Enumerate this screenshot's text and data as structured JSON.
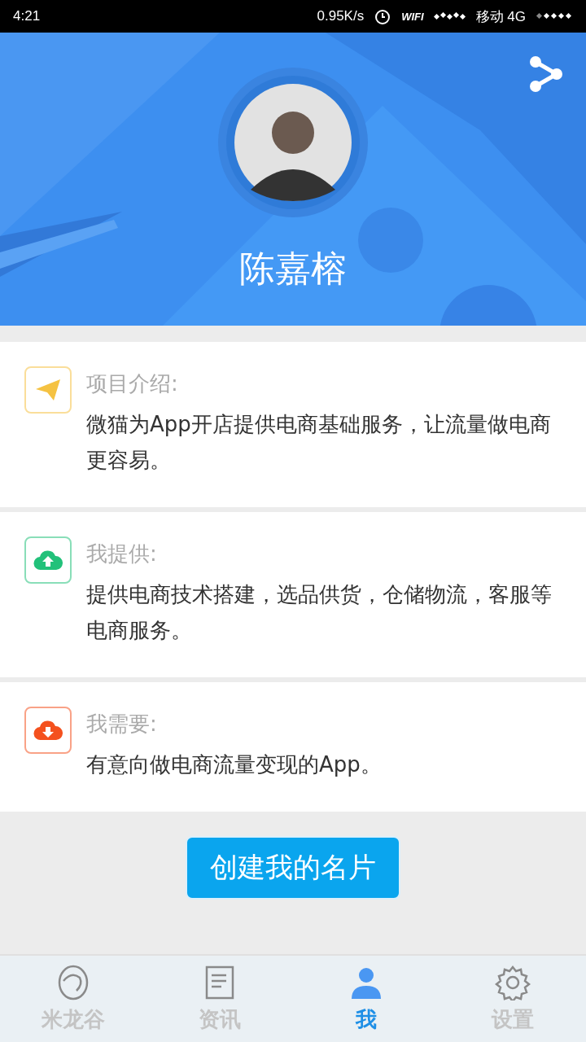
{
  "status_bar": {
    "time": "4:21",
    "speed": "0.95K/s",
    "wifi": "WIFI",
    "carrier": "移动 4G"
  },
  "profile": {
    "name": "陈嘉榕"
  },
  "sections": [
    {
      "kind": "intro",
      "color": "#f5c242",
      "title": "项目介绍:",
      "text": "微猫为App开店提供电商基础服务，让流量做电商更容易。"
    },
    {
      "kind": "offer",
      "color": "#22c17a",
      "title": "我提供:",
      "text": "提供电商技术搭建，选品供货，仓储物流，客服等电商服务。"
    },
    {
      "kind": "need",
      "color": "#f4511e",
      "title": "我需要:",
      "text": "有意向做电商流量变现的App。"
    }
  ],
  "create_button": "创建我的名片",
  "tabs": [
    {
      "kind": "valley",
      "label": "米龙谷",
      "selected": false
    },
    {
      "kind": "news",
      "label": "资讯",
      "selected": false
    },
    {
      "kind": "me",
      "label": "我",
      "selected": true
    },
    {
      "kind": "settings",
      "label": "设置",
      "selected": false
    }
  ]
}
